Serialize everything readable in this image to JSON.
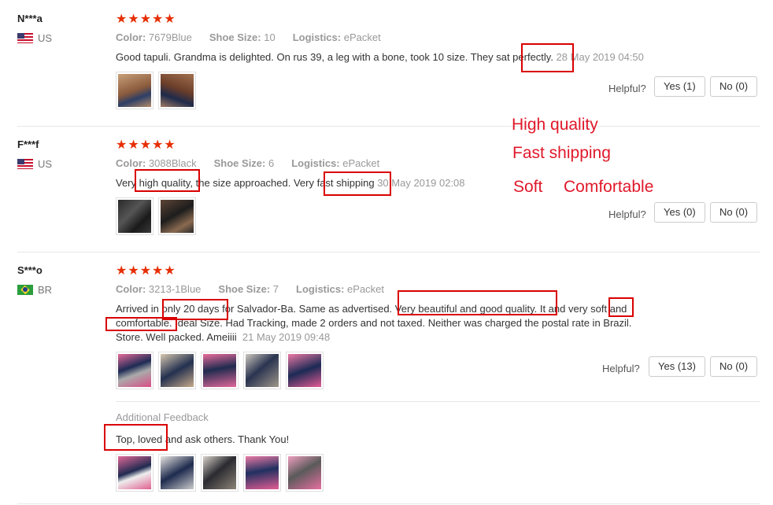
{
  "labels": {
    "color": "Color:",
    "shoe_size": "Shoe Size:",
    "logistics": "Logistics:",
    "helpful": "Helpful?",
    "additional_feedback": "Additional Feedback"
  },
  "stars": "★★★★★",
  "reviews": [
    {
      "user": "N***a",
      "country": "US",
      "color": "7679Blue",
      "shoe_size": "10",
      "logistics": "ePacket",
      "text": "Good tapuli. Grandma is delighted. On rus 39, a leg with a bone, took 10 size. They sat perfectly.",
      "date": "28 May 2019 04:50",
      "yes": "Yes (1)",
      "no": "No (0)"
    },
    {
      "user": "F***f",
      "country": "US",
      "color": "3088Black",
      "shoe_size": "6",
      "logistics": "ePacket",
      "text": "Very high quality, the size approached. Very fast shipping",
      "date": "30 May 2019 02:08",
      "yes": "Yes (0)",
      "no": "No (0)"
    },
    {
      "user": "S***o",
      "country": "BR",
      "color": "3213-1Blue",
      "shoe_size": "7",
      "logistics": "ePacket",
      "text_line1": "Arrived in only 20 days for Salvador-Ba. Same as advertised. Very beautiful and good quality. It and very soft and",
      "text_line2": "comfortable. Ideal Size. Had Tracking, made 2 orders and not taxed. Neither was charged the postal rate in Brazil.",
      "text_line3": "Store. Well packed. Ameiiii",
      "date": "21 May 2019 09:48",
      "yes": "Yes (13)",
      "no": "No (0)",
      "additional": "Top, loved and ask others. Thank You!"
    }
  ],
  "annotations": {
    "high_quality": "High quality",
    "fast_shipping": "Fast shipping",
    "soft": "Soft",
    "comfortable": "Comfortable"
  },
  "colors": {
    "star": "#e62e04",
    "highlight_box": "#d90000",
    "annotation": "#e0182a"
  }
}
